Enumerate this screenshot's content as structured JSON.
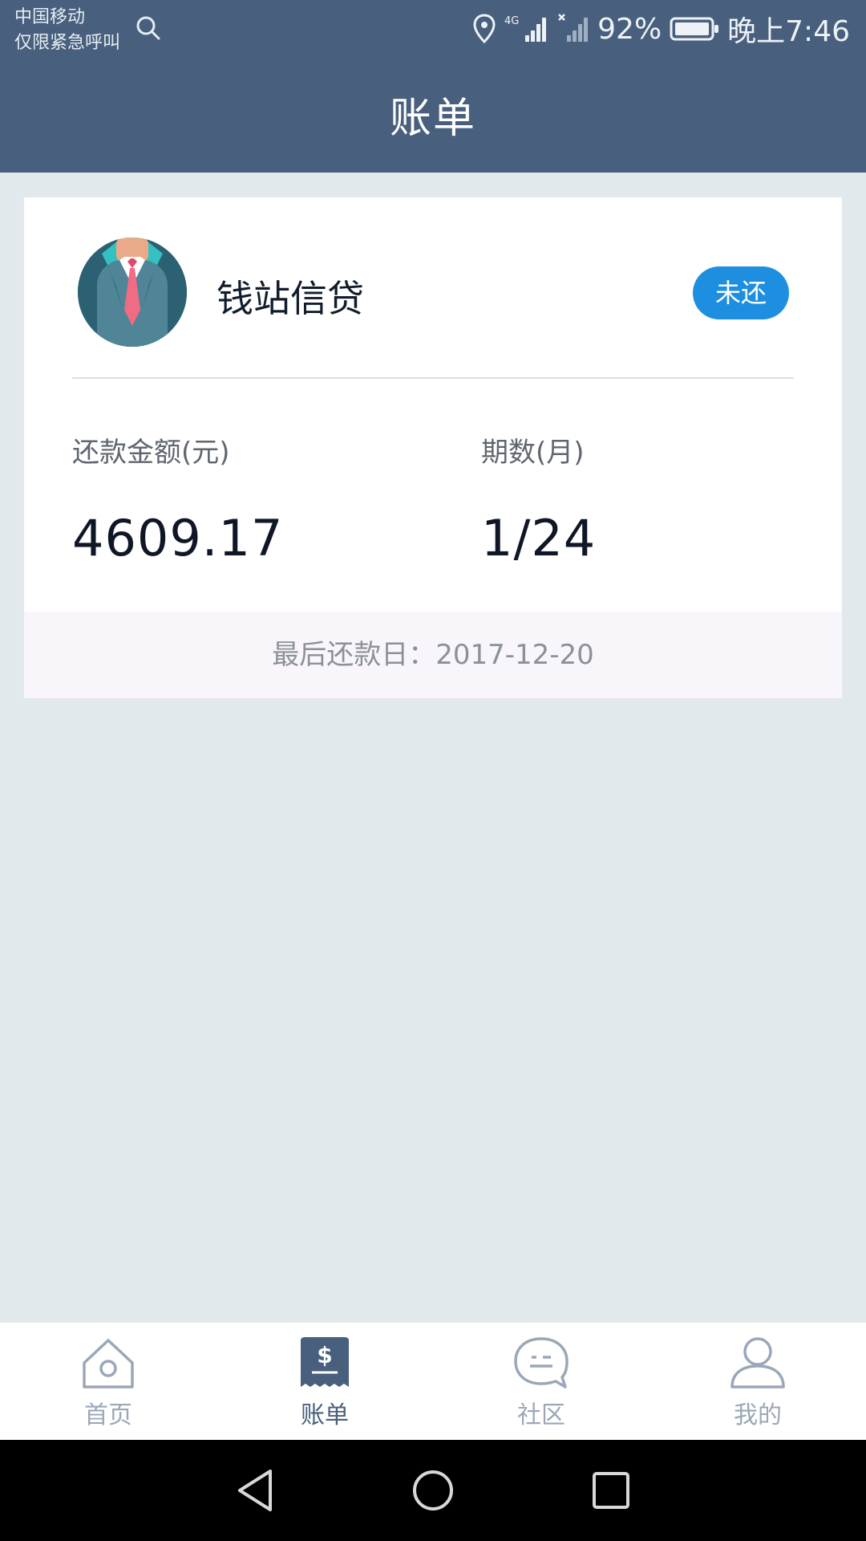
{
  "status_bar": {
    "carrier_line1": "中国移动",
    "carrier_line2": "仅限紧急呼叫",
    "battery": "92%",
    "time": "晚上7:46",
    "network": "4G"
  },
  "header": {
    "title": "账单"
  },
  "bill": {
    "lender": "钱站信贷",
    "status": "未还",
    "amount_label": "还款金额(元)",
    "amount": "4609.17",
    "period_label": "期数(月)",
    "period": "1/24",
    "due": "最后还款日：2017-12-20"
  },
  "tabs": [
    {
      "label": "首页",
      "icon": "home-icon",
      "active": false
    },
    {
      "label": "账单",
      "icon": "bill-icon",
      "active": true
    },
    {
      "label": "社区",
      "icon": "chat-icon",
      "active": false
    },
    {
      "label": "我的",
      "icon": "user-icon",
      "active": false
    }
  ],
  "colors": {
    "header": "#485f7d",
    "background": "#e2e9ed",
    "badge": "#1e8fe0",
    "tab_inactive": "#9aa7b8"
  }
}
